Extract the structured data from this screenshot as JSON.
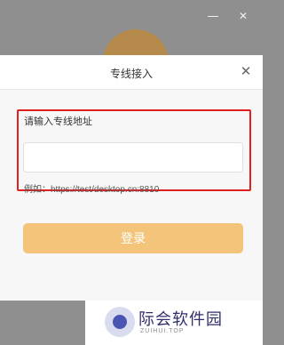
{
  "dialog": {
    "title": "专线接入",
    "field_label": "请输入专线地址",
    "input_value": "",
    "input_placeholder": "",
    "example_text": "例如：https://test/desktop.cn:8810",
    "login_label": "登录"
  },
  "colors": {
    "highlight": "#e02121",
    "login_button": "#f4c47a",
    "logo": "#b68a4b"
  },
  "icons": {
    "dialog_close": "close-icon",
    "window_minimize": "minimize-icon",
    "window_close": "close-icon"
  },
  "watermark": {
    "brand": "际会软件园",
    "sub": "ZUIHUI.TOP"
  }
}
